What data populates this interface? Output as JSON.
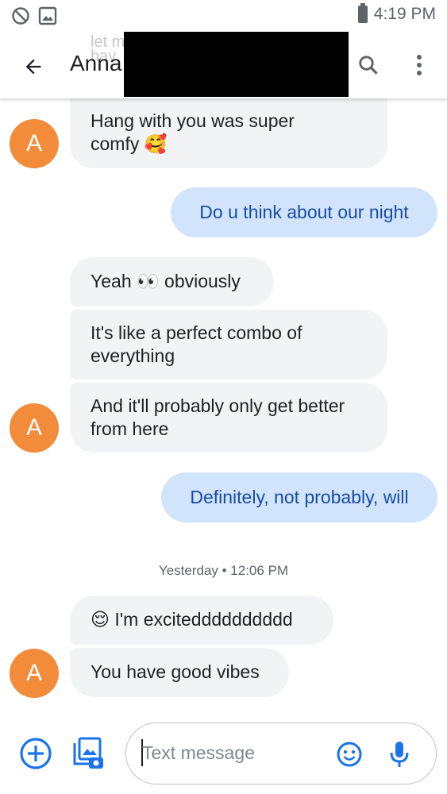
{
  "status_bar": {
    "time": "4:19 PM"
  },
  "app_bar": {
    "title": "Anna",
    "ghost_text": "let m\nhav"
  },
  "contact": {
    "avatar_letter": "A",
    "avatar_color": "#f28b3a"
  },
  "messages": [
    {
      "direction": "incoming",
      "text_line1": "Hang with you was super",
      "text_line2": "comfy 🥰"
    },
    {
      "direction": "outgoing",
      "text": "Do u think about our night"
    },
    {
      "direction": "incoming",
      "text": "Yeah 👀 obviously"
    },
    {
      "direction": "incoming",
      "text_line1": "It's like a perfect combo of",
      "text_line2": "everything"
    },
    {
      "direction": "incoming",
      "text_line1": "And it'll probably only get better",
      "text_line2": "from here"
    },
    {
      "direction": "outgoing",
      "text": "Definitely, not probably, will"
    },
    {
      "direction": "incoming",
      "text": "😌 I'm excitedddddddddd"
    },
    {
      "direction": "incoming",
      "text": "You have good vibes"
    }
  ],
  "timestamp": "Yesterday • 12:06 PM",
  "composer": {
    "placeholder": "Text message"
  },
  "colors": {
    "incoming_bubble": "#f1f3f4",
    "outgoing_bubble": "#d2e3fc",
    "outgoing_text": "#174ea6",
    "accent": "#1a73e8"
  },
  "icons": [
    "do-not-disturb-icon",
    "image-notification-icon",
    "back-arrow-icon",
    "search-icon",
    "more-vert-icon",
    "add-circle-icon",
    "gallery-icon",
    "emoji-icon",
    "mic-icon"
  ]
}
